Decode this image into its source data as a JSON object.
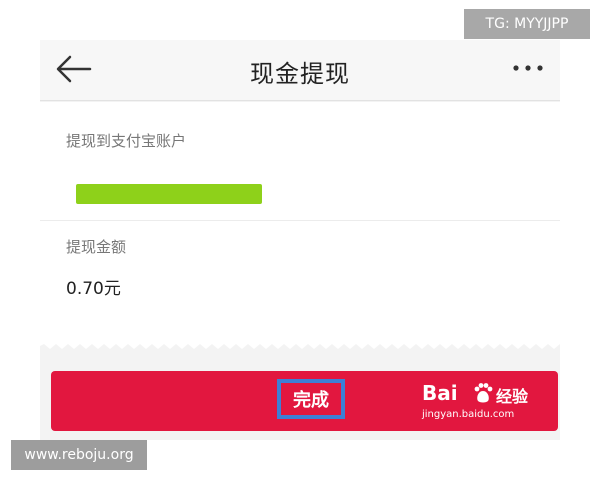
{
  "header": {
    "title": "现金提现",
    "back_icon": "arrow-left-icon",
    "more_icon": "more-dots-icon"
  },
  "form": {
    "account_label": "提现到支付宝账户",
    "account_value_redacted": true,
    "amount_label": "提现金额",
    "amount_value": "0.70元"
  },
  "action": {
    "done_label": "完成",
    "color": "#e2173f",
    "highlight_color": "#3d7fd6"
  },
  "watermarks": {
    "baidu_brand_text": "Bai",
    "baidu_brand_suffix": "经验",
    "baidu_url": "jingyan.baidu.com",
    "tg_tag": "TG: MYYJJPP",
    "site_tag": "www.reboju.org"
  }
}
